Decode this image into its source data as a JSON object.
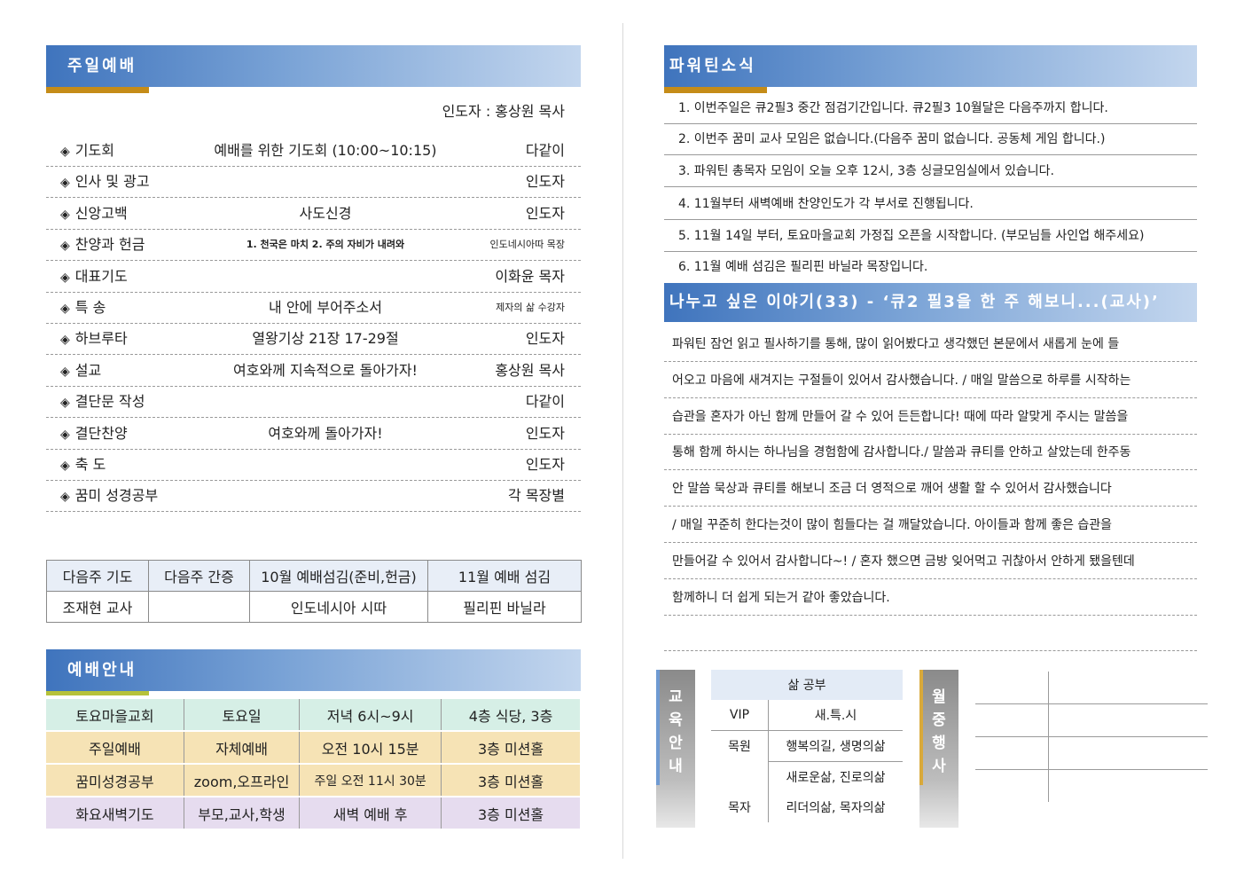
{
  "left": {
    "worship_title": "주일예배",
    "leader_line": "인도자 : 홍상원 목사",
    "order": [
      {
        "name": "기도회",
        "content": "예배를 위한 기도회 (10:00~10:15)",
        "person": "다같이"
      },
      {
        "name": "인사 및 광고",
        "content": "",
        "person": "인도자"
      },
      {
        "name": "신앙고백",
        "content": "사도신경",
        "person": "인도자"
      },
      {
        "name": "찬양과 헌금",
        "content": "1. 천국은 마치 2. 주의 자비가 내려와",
        "person": "인도네시아따 목장"
      },
      {
        "name": "대표기도",
        "content": "",
        "person": "이화윤 목자"
      },
      {
        "name": "특 송",
        "content": "내 안에 부어주소서",
        "person": "제자의 삶 수강자"
      },
      {
        "name": "하브루타",
        "content": "열왕기상 21장 17-29절",
        "person": "인도자"
      },
      {
        "name": "설교",
        "content": "여호와께 지속적으로 돌아가자!",
        "person": "홍상원 목사"
      },
      {
        "name": "결단문 작성",
        "content": "",
        "person": "다같이"
      },
      {
        "name": "결단찬양",
        "content": "여호와께 돌아가자!",
        "person": "인도자"
      },
      {
        "name": "축 도",
        "content": "",
        "person": "인도자"
      },
      {
        "name": "꿈미 성경공부",
        "content": "",
        "person": "각 목장별"
      }
    ],
    "bullet": "◈",
    "next_week": {
      "headers": [
        "다음주 기도",
        "다음주 간증",
        "10월 예배섬김(준비,헌금)",
        "11월 예배 섬김"
      ],
      "values": [
        "조재현 교사",
        "",
        "인도네시아 시따",
        "필리핀 바닐라"
      ]
    },
    "guide_title": "예배안내",
    "services": [
      {
        "cells": [
          "토요마을교회",
          "토요일",
          "저녁 6시~9시",
          "4층 식당, 3층"
        ],
        "color": "#d6efe6"
      },
      {
        "cells": [
          "주일예배",
          "자체예배",
          "오전 10시 15분",
          "3층 미션홀"
        ],
        "color": "#f6e3b5"
      },
      {
        "cells": [
          "꿈미성경공부",
          "zoom,오프라인",
          "주일 오전 11시 30분",
          "3층 미션홀"
        ],
        "color": "#f6e3b5"
      },
      {
        "cells": [
          "화요새벽기도",
          "부모,교사,학생",
          "새벽 예배 후",
          "3층 미션홀"
        ],
        "color": "#e6dcef"
      }
    ]
  },
  "right": {
    "news_title": "파워틴소식",
    "news": [
      "1. 이번주일은 큐2필3 중간 점검기간입니다. 큐2필3 10월달은 다음주까지 합니다.",
      "2. 이번주 꿈미 교사 모임은 없습니다.(다음주 꿈미 없습니다. 공동체 게임 합니다.)",
      "3. 파워틴 총목자 모임이 오늘 오후 12시, 3층 싱글모임실에서 있습니다.",
      "4. 11월부터 새벽예배 찬양인도가 각 부서로 진행됩니다.",
      "5. 11월 14일 부터, 토요마을교회 가정집 오픈을 시작합니다. (부모님들 사인업 해주세요)",
      "6. 11월 예배 섬김은 필리핀 바닐라 목장입니다."
    ],
    "story_title": "나누고 싶은 이야기(33) - ‘큐2 필3을 한 주 해보니...(교사)’",
    "story_lines": [
      "파워틴 잠언 읽고 필사하기를 통해, 많이 읽어봤다고 생각했던 본문에서 새롭게 눈에 들",
      "어오고 마음에 새겨지는 구절들이 있어서 감사했습니다. / 매일 말씀으로 하루를 시작하는",
      "습관을 혼자가 아닌 함께 만들어 갈 수 있어 든든합니다! 때에 따라 알맞게 주시는 말씀을",
      "통해 함께 하시는 하나님을 경험함에 감사합니다./ 말씀과 큐티를 안하고 살았는데 한주동",
      "안 말씀 묵상과 큐티를 해보니 조금 더 영적으로 깨어 생활 할 수 있어서 감사했습니다",
      " / 매일 꾸준히 한다는것이 많이 힘들다는 걸 깨달았습니다. 아이들과 함께 좋은 습관을",
      "만들어갈 수 있어서 감사합니다~! / 혼자 했으면 금방 잊어먹고 귀찮아서 안하게 됐을텐데",
      "함께하니 더 쉽게 되는거 같아 좋았습니다.",
      ""
    ],
    "edu_label": [
      "교",
      "육",
      "안",
      "내"
    ],
    "edu": {
      "header": "삶 공부",
      "rows": [
        {
          "level": "VIP",
          "courses": "새.특.시"
        },
        {
          "level": "목원",
          "courses": "행복의길, 생명의삶"
        },
        {
          "level": "",
          "courses": "새로운삶, 진로의삶"
        },
        {
          "level": "목자",
          "courses": "리더의삶, 목자의삶"
        }
      ]
    },
    "monthly_label": [
      "월",
      "중",
      "행",
      "사"
    ]
  },
  "colors": {
    "banner_bar": "#c58c18",
    "banner_bar_green": "#b6c23a",
    "edu_header": "#e3ebf6"
  }
}
